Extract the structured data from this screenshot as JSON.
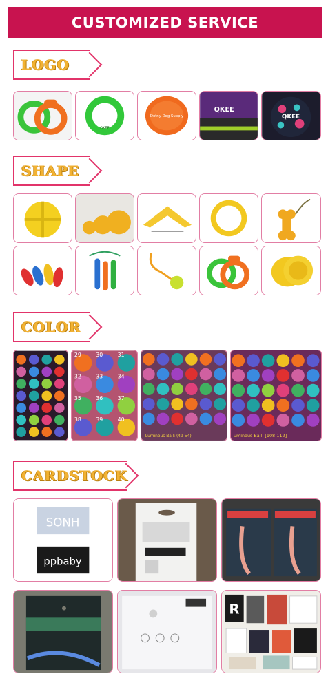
{
  "banner": {
    "title": "CUSTOMIZED SERVICE"
  },
  "sections": {
    "logo": "LOGO",
    "shape": "SHAPE",
    "color": "COLOR",
    "cardstock": "CARDSTOCK"
  },
  "logo_texts": {
    "qkee_ring": "QKEE",
    "dog_supply": "Dotny Dog Supply",
    "qkee_bag": "QKEE",
    "qkee_ball": "QKEE"
  },
  "color_labels": {
    "panel2": [
      "29",
      "30",
      "31",
      "32",
      "33",
      "34",
      "35",
      "36",
      "37",
      "38",
      "39",
      "40"
    ],
    "panel3_caption": "Luminous Ball: (49-54)",
    "panel4_caption": "uminous Ball: [108-112]"
  },
  "cardstock_texts": {
    "brand1": "SONH",
    "brand2": "ppbaby",
    "hang_tag_r": "R"
  },
  "colors": {
    "banner": "#c8134f",
    "tag_border": "#e2346a",
    "tag_text": "#f2b233",
    "tile_border": "#e27ea4"
  }
}
